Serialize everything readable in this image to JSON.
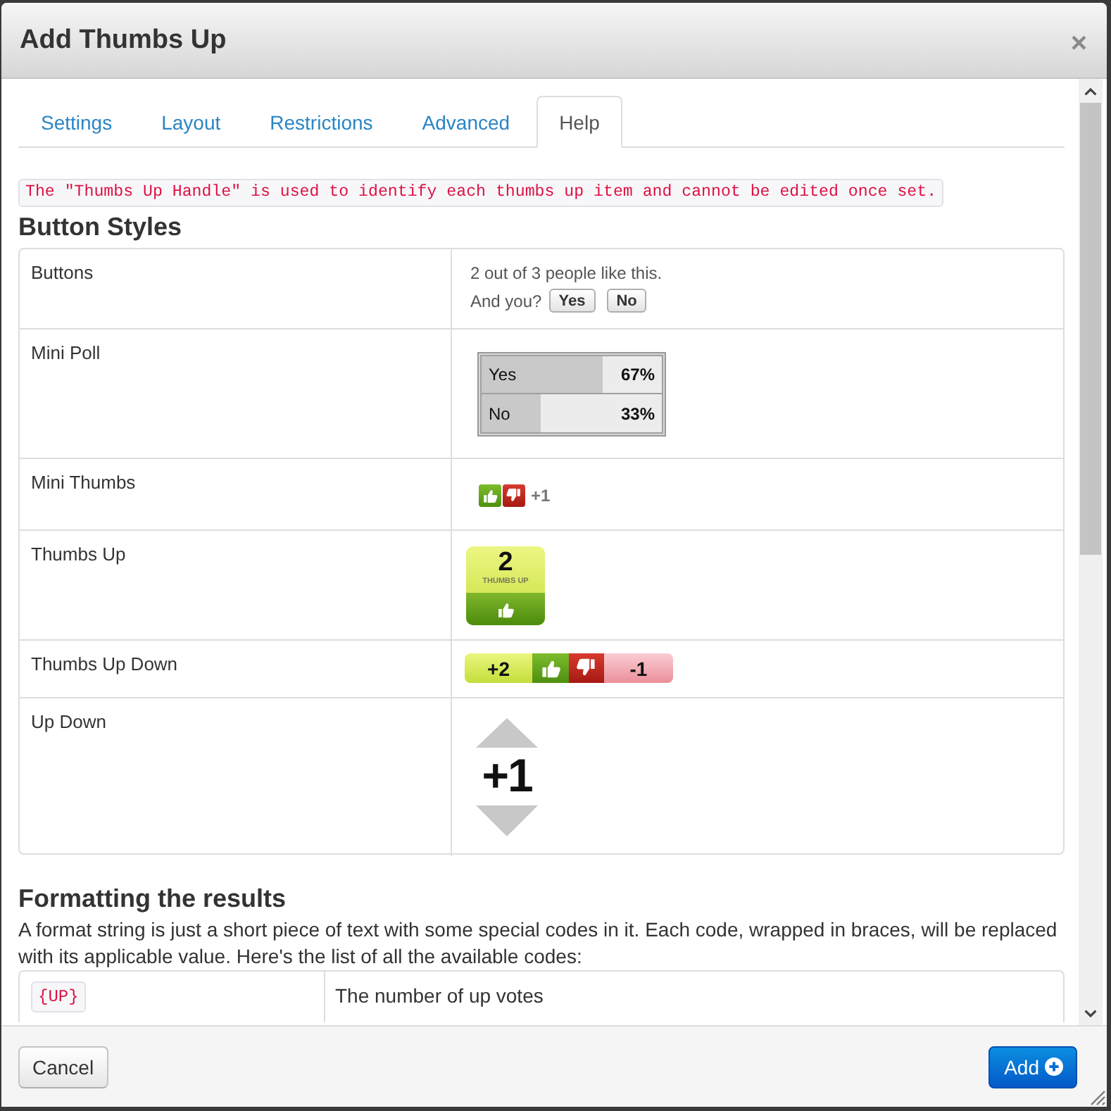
{
  "window": {
    "title": "Add Thumbs Up",
    "close_label": "×"
  },
  "tabs": [
    {
      "label": "Settings",
      "selected": false
    },
    {
      "label": "Layout",
      "selected": false
    },
    {
      "label": "Restrictions",
      "selected": false
    },
    {
      "label": "Advanced",
      "selected": false
    },
    {
      "label": "Help",
      "selected": true
    }
  ],
  "notice": "The \"Thumbs Up Handle\" is used to identify each thumbs up item and cannot be edited once set.",
  "button_styles": {
    "heading": "Button Styles",
    "rows": [
      {
        "kind": "buttons",
        "name": "Buttons",
        "summary": "2 out of 3 people like this.",
        "prompt": "And you?",
        "buttons": [
          "Yes",
          "No"
        ]
      },
      {
        "kind": "mini_poll",
        "name": "Mini Poll",
        "options": [
          {
            "label": "Yes",
            "percent": "67%",
            "level": 0.67
          },
          {
            "label": "No",
            "percent": "33%",
            "level": 0.33
          }
        ]
      },
      {
        "kind": "mini_thumbs",
        "name": "Mini Thumbs",
        "score": "+1"
      },
      {
        "kind": "thumbs_up",
        "name": "Thumbs Up",
        "count": "2",
        "caption": "THUMBS UP"
      },
      {
        "kind": "thumbs_up_down",
        "name": "Thumbs Up Down",
        "up_score": "+2",
        "down_score": "-1"
      },
      {
        "kind": "up_down",
        "name": "Up Down",
        "score": "+1"
      }
    ]
  },
  "formatting": {
    "heading": "Formatting the results",
    "intro": "A format string is just a short piece of text with some special codes in it. Each code, wrapped in braces, will be replaced with its applicable value. Here's the list of all the available codes:",
    "codes": [
      {
        "code": "{UP}",
        "description": "The number of up votes"
      }
    ]
  },
  "footer": {
    "cancel": "Cancel",
    "add": "Add"
  }
}
